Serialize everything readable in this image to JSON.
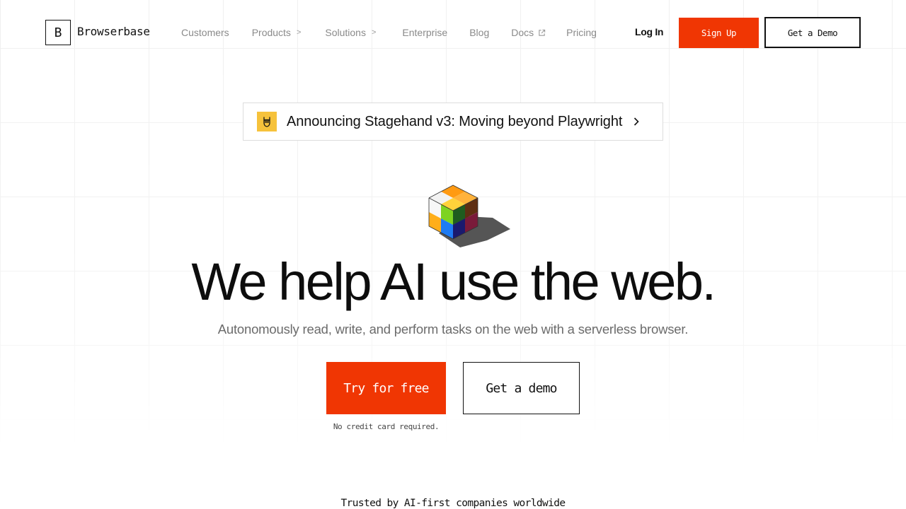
{
  "brand": {
    "logo_letter": "B",
    "name": "Browserbase",
    "accent_color": "#f03603"
  },
  "nav": {
    "links": [
      {
        "label": "Customers",
        "has_submenu": false
      },
      {
        "label": "Products",
        "has_submenu": true
      },
      {
        "label": "Solutions",
        "has_submenu": true
      },
      {
        "label": "Enterprise",
        "has_submenu": false
      },
      {
        "label": "Blog",
        "has_submenu": false
      },
      {
        "label": "Docs",
        "external": true
      },
      {
        "label": "Pricing",
        "has_submenu": false
      }
    ],
    "login_label": "Log In",
    "signup_label": "Sign Up",
    "demo_label": "Get a Demo",
    "chevron_glyph": ">",
    "icons": {
      "submenu": "chevron-right-icon",
      "external": "external-link-icon"
    }
  },
  "announcement": {
    "text": "Announcing Stagehand v3: Moving beyond Playwright",
    "icon": "rock-hand-icon",
    "icon_bg": "#f6c23b"
  },
  "hero": {
    "illustration": "rubiks-cube-icon",
    "headline": "We help AI use the web.",
    "subheadline": "Autonomously read, write, and perform tasks on the web with a serverless browser.",
    "primary_cta": "Try for free",
    "secondary_cta": "Get a demo",
    "footnote": "No credit card required."
  },
  "trusted": {
    "text": "Trusted by AI-first companies worldwide"
  }
}
